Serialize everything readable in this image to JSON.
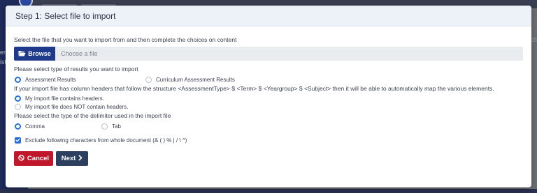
{
  "background": {
    "sidebar_fragments": [
      "er",
      "ist"
    ],
    "right_fragment": "ch"
  },
  "modal": {
    "title": "Step 1: Select file to import",
    "intro": "Select the file that you want to import from and then complete the choices on content",
    "browse_label": "Browse",
    "file_placeholder": "Choose a file",
    "results_type": {
      "prompt": "Please select type of results you want to import",
      "options": [
        {
          "label": "Assessment Results",
          "selected": true
        },
        {
          "label": "Curriculum Assessment Results",
          "selected": false
        }
      ]
    },
    "headers": {
      "info": "If your import file has column headers that follow the structure <AssessmentType> $ <Term> $ <Yeargroup> $ <Subject> then it will be able to automatically map the various elements.",
      "options": [
        {
          "label": "My import file contains headers.",
          "selected": true
        },
        {
          "label": "My import file does NOT contain headers.",
          "selected": false
        }
      ]
    },
    "delimiter": {
      "prompt": "Please select the type of the delimiter used in the import file",
      "options": [
        {
          "label": "Comma",
          "selected": true
        },
        {
          "label": "Tab",
          "selected": false
        }
      ]
    },
    "exclude": {
      "label": "Exclude following characters from whole document (& ( ) % | / \\ ^)",
      "checked": true
    },
    "cancel_label": "Cancel",
    "next_label": "Next"
  },
  "colors": {
    "primary": "#1f3a8a",
    "accent": "#2a6fd6",
    "danger": "#c0182a",
    "next": "#2d3f5f"
  },
  "icons": {
    "browse": "folder-open-icon",
    "cancel": "ban-icon",
    "next": "chevron-right-icon"
  }
}
